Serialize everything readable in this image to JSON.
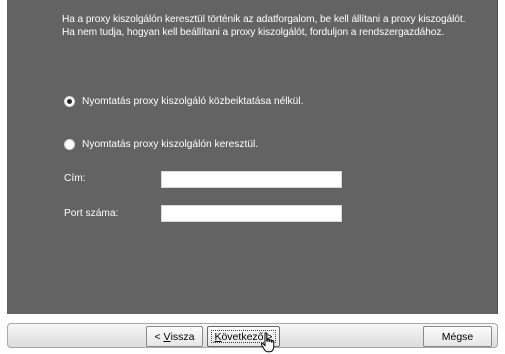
{
  "intro": {
    "line1": "Ha a proxy kiszolgálón keresztül történik az adatforgalom, be kell állítani a proxy kiszogálót.",
    "line2": "Ha nem tudja, hogyan kell beállítani a proxy kiszolgálót, forduljon a rendszergazdához."
  },
  "options": {
    "direct": {
      "label": "Nyomtatás proxy kiszolgáló közbeiktatása nélkül.",
      "selected": true
    },
    "proxy": {
      "label": "Nyomtatás proxy kiszolgálón keresztül.",
      "selected": false
    }
  },
  "fields": {
    "address": {
      "label": "Cím:",
      "value": ""
    },
    "port": {
      "label": "Port száma:",
      "value": ""
    }
  },
  "buttons": {
    "back": {
      "prefix": "< ",
      "mnemonic": "V",
      "rest": "issza"
    },
    "next": {
      "mnemonic": "K",
      "rest": "övetkező >"
    },
    "cancel": {
      "label": "Mégse"
    }
  },
  "colors": {
    "panel": "#636363",
    "text": "#ffffff"
  },
  "icons": {
    "cursor": "hand-pointer-icon"
  }
}
